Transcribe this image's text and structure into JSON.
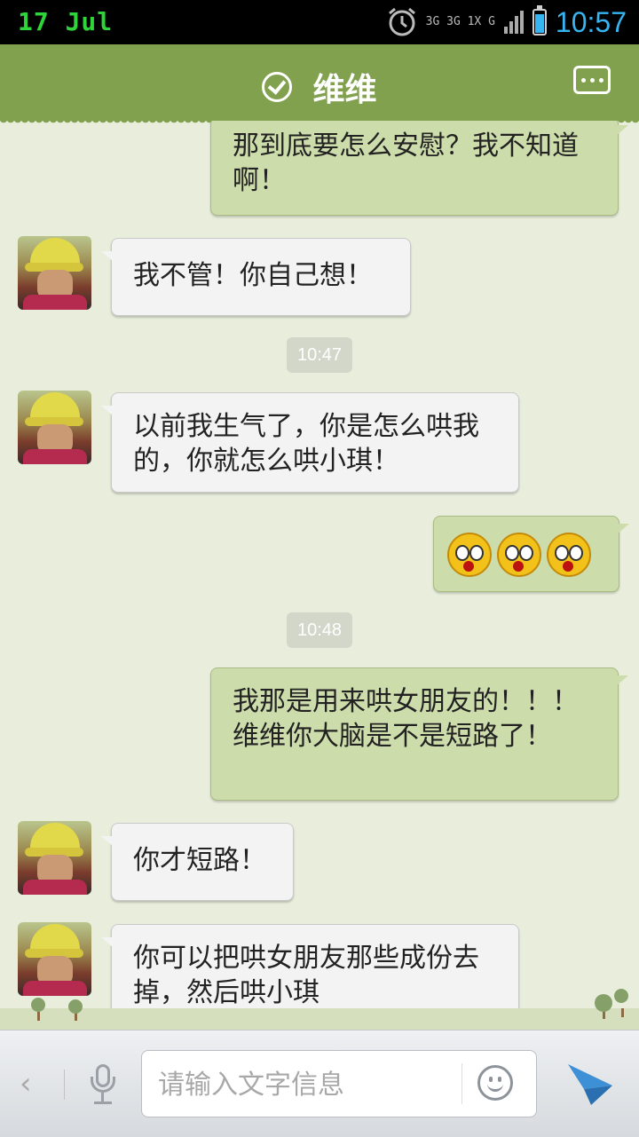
{
  "status_bar": {
    "date": "17 Jul",
    "network": "3G 3G 1X G",
    "time": "10:57"
  },
  "header": {
    "title": "维维",
    "verified_icon": "check-circle-icon",
    "more_icon": "more-options-icon"
  },
  "messages": [
    {
      "side": "out",
      "text": "那到底要怎么安慰？我不知道啊！"
    },
    {
      "side": "in",
      "text": "我不管！你自己想！"
    },
    {
      "type": "time",
      "text": "10:47"
    },
    {
      "side": "in",
      "text": "以前我生气了，你是怎么哄我的，你就怎么哄小琪！"
    },
    {
      "side": "out",
      "emoji": [
        "shocked-face-icon",
        "shocked-face-icon",
        "shocked-face-icon"
      ]
    },
    {
      "type": "time",
      "text": "10:48"
    },
    {
      "side": "out",
      "text": "我那是用来哄女朋友的！！！维维你大脑是不是短路了！"
    },
    {
      "side": "in",
      "text": "你才短路！"
    },
    {
      "side": "in",
      "text": "你可以把哄女朋友那些成份去掉，然后哄小琪"
    }
  ],
  "input_bar": {
    "back_icon": "chevron-left-icon",
    "voice_icon": "microphone-icon",
    "placeholder": "请输入文字信息",
    "emoji_icon": "smiley-icon",
    "send_icon": "send-icon"
  },
  "colors": {
    "header": "#81a14e",
    "outgoing_bubble": "#cddcab",
    "incoming_bubble": "#f3f3f3",
    "time_accent": "#36b5f0"
  }
}
